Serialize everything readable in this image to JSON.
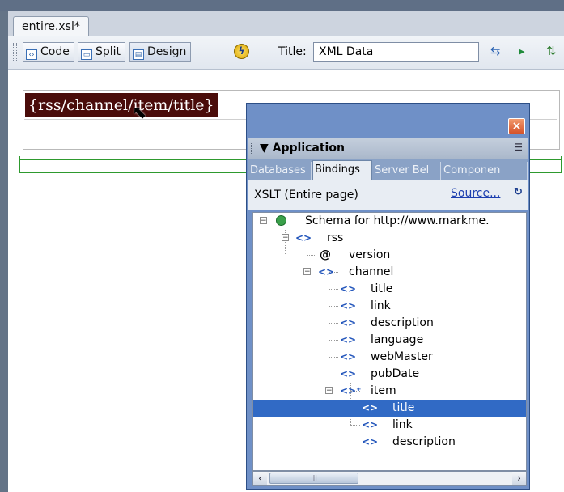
{
  "document_tab": {
    "label": "entire.xsl*"
  },
  "toolbar": {
    "code_label": "Code",
    "split_label": "Split",
    "design_label": "Design",
    "title_label": "Title:",
    "title_value": "XML Data"
  },
  "design_view": {
    "selected_expression": "{rss/channel/item/title}"
  },
  "panel": {
    "close_symbol": "×",
    "group_title": "Application",
    "tabs": [
      "Databases",
      "Bindings",
      "Server Bel",
      "Componen"
    ],
    "selected_tab": "Bindings",
    "scope_label": "XSLT (Entire page)",
    "source_link": "Source...",
    "tree": {
      "schema": "Schema for http://www.markme.",
      "rss": "rss",
      "version": "version",
      "channel": "channel",
      "channel_children": [
        "title",
        "link",
        "description",
        "language",
        "webMaster",
        "pubDate"
      ],
      "item": "item",
      "item_children": [
        "title",
        "link",
        "description"
      ]
    },
    "selected_node": "title"
  },
  "colors": {
    "expression_bg": "#4a0c0a",
    "panel_frame": "#6f90c7",
    "selection": "#316ac5",
    "guide_green": "#2e9a2e"
  }
}
